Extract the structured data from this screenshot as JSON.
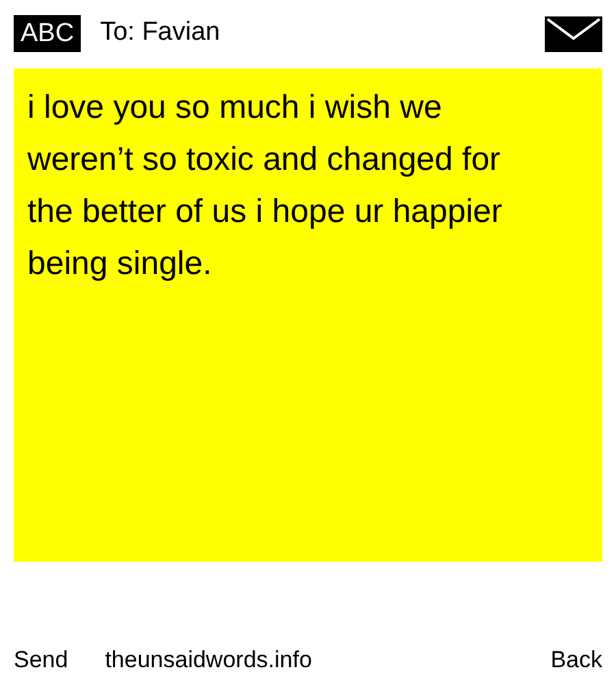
{
  "header": {
    "badge": "ABC",
    "recipient": "To: Favian"
  },
  "message": "i love you so much i wish we weren’t so toxic and changed for the better of us i hope ur happier being single.",
  "footer": {
    "send": "Send",
    "site": "theunsaidwords.info",
    "back": "Back"
  }
}
